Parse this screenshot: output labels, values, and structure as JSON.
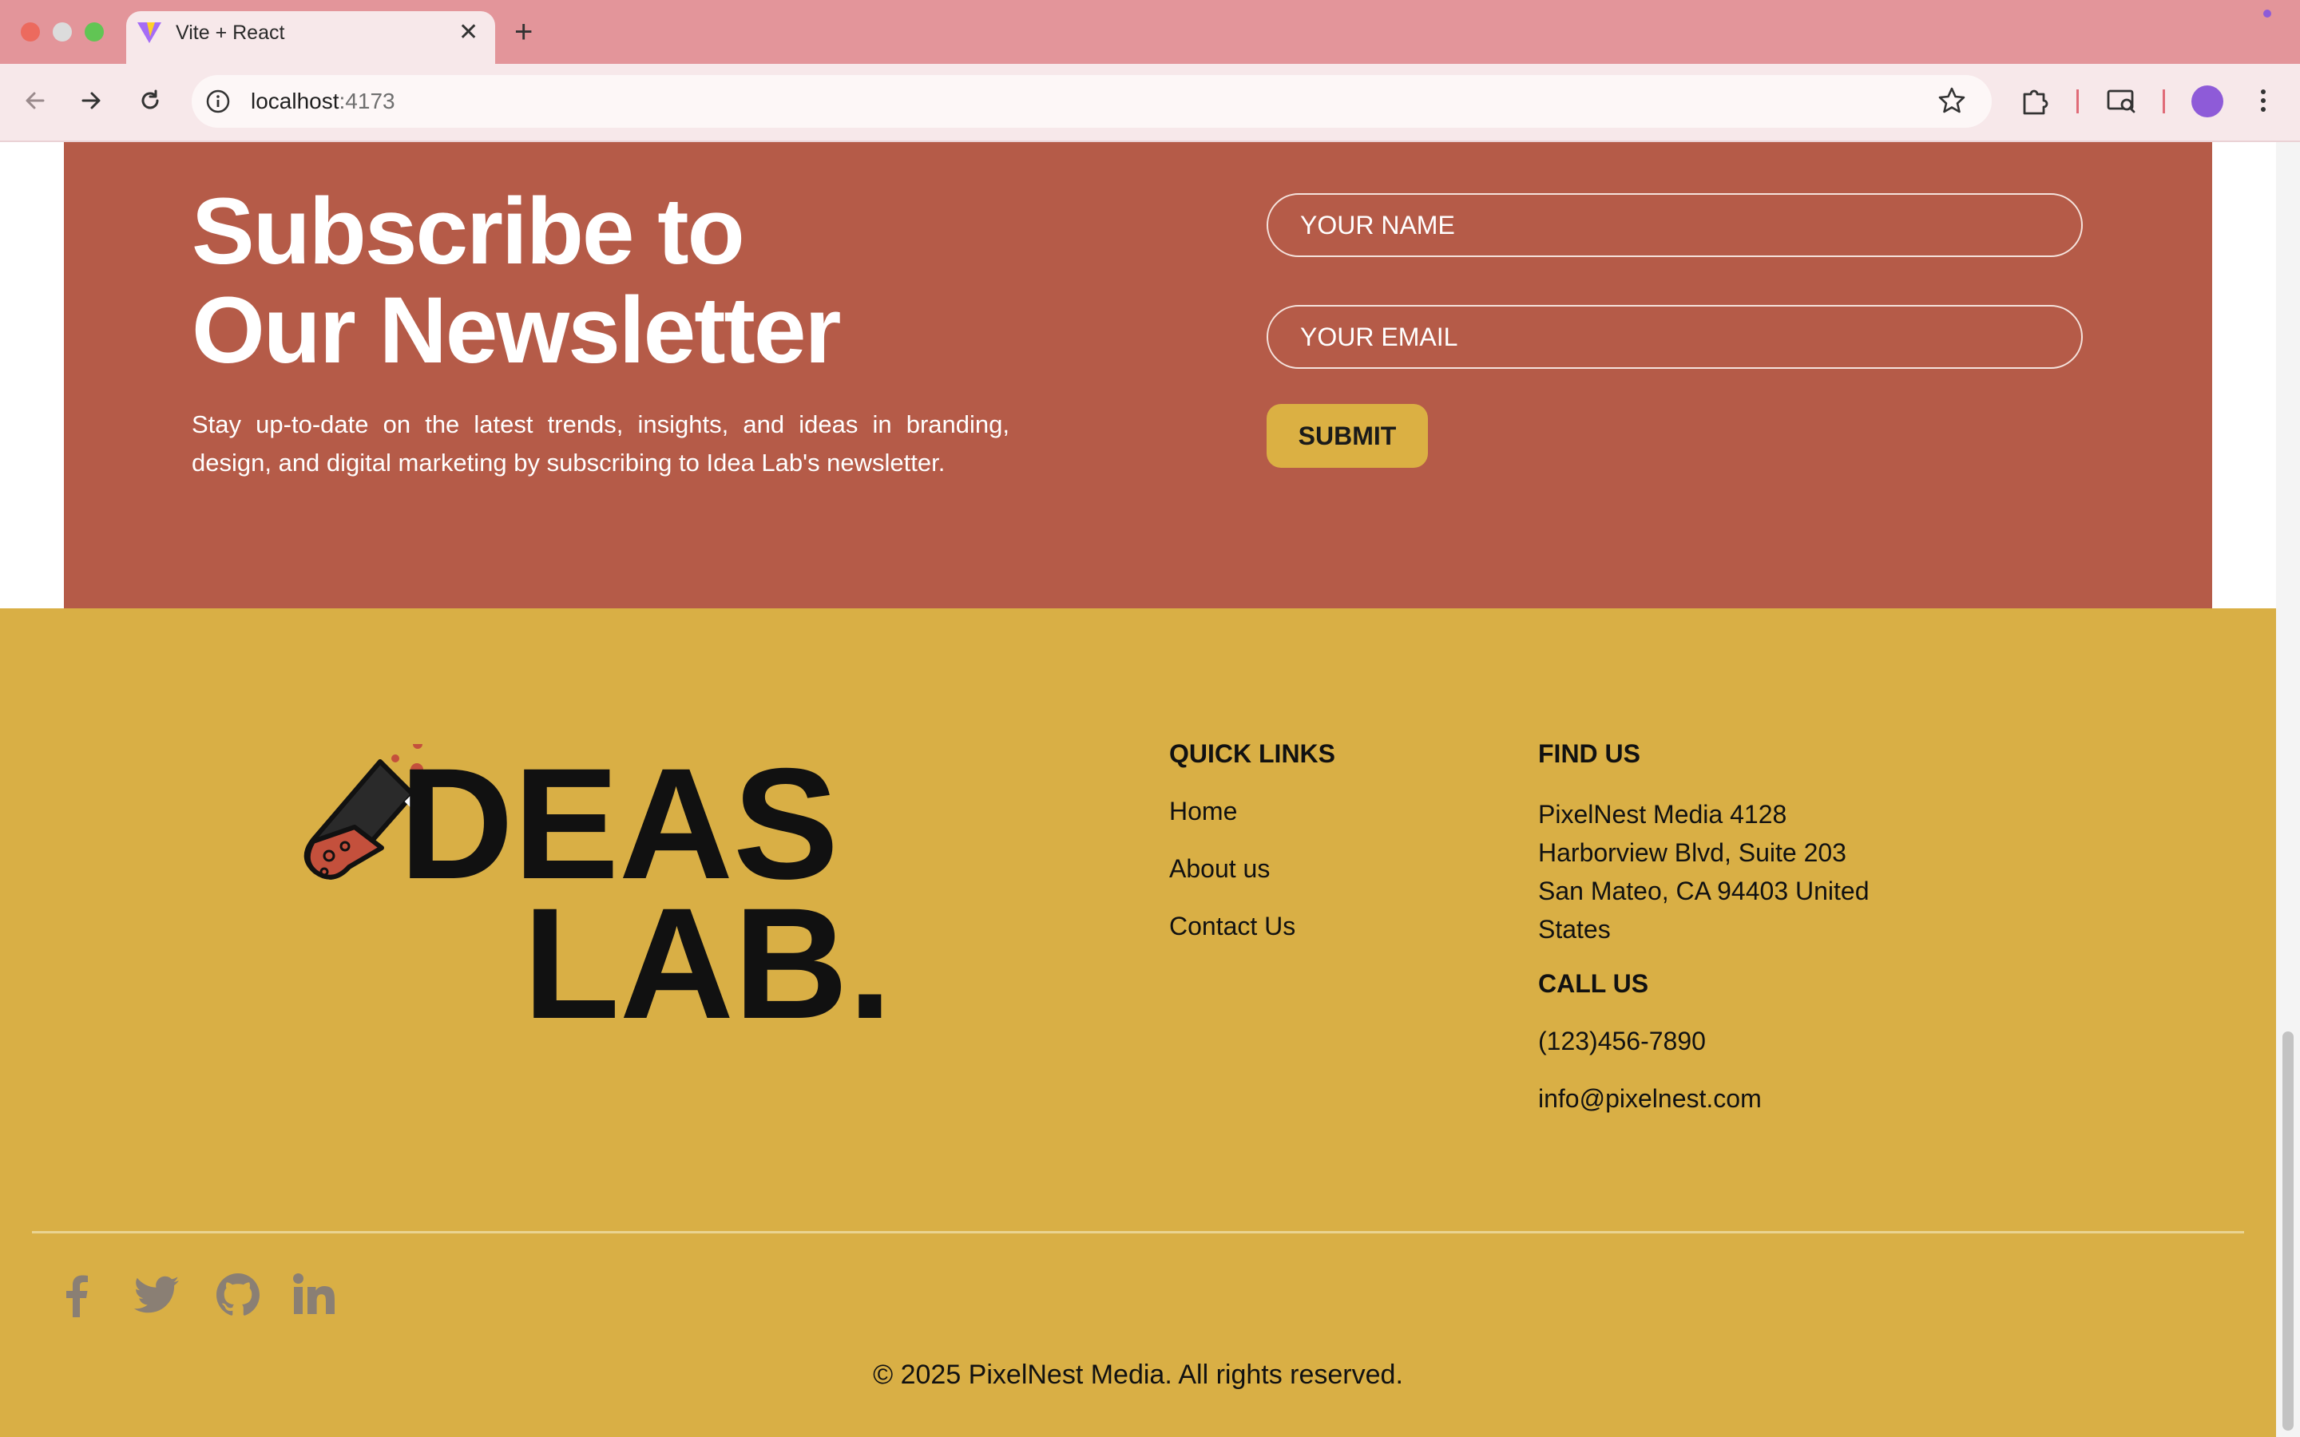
{
  "browser": {
    "tab_title": "Vite + React",
    "url_host": "localhost",
    "url_port": ":4173"
  },
  "newsletter": {
    "title_line1": "Subscribe to",
    "title_line2": "Our Newsletter",
    "description": "Stay up-to-date on the latest trends, insights, and ideas in branding, design, and digital marketing by subscribing to Idea Lab's newsletter.",
    "name_placeholder": "YOUR NAME",
    "email_placeholder": "YOUR EMAIL",
    "submit_label": "SUBMIT"
  },
  "footer": {
    "logo_text_line1": "DEAS",
    "logo_text_line2": "LAB.",
    "quick_links": {
      "heading": "QUICK LINKS",
      "items": [
        "Home",
        "About us",
        "Contact Us"
      ]
    },
    "find_us": {
      "heading": "FIND US",
      "address": "PixelNest Media 4128 Harborview Blvd, Suite 203 San Mateo, CA 94403 United States"
    },
    "call_us": {
      "heading": "CALL US",
      "phone": "(123)456-7890",
      "email": "info@pixelnest.com"
    },
    "social_icons": [
      "facebook-icon",
      "twitter-icon",
      "github-icon",
      "linkedin-icon"
    ],
    "copyright": "© 2025 PixelNest Media. All rights reserved."
  },
  "colors": {
    "newsletter_bg": "#b55b48",
    "footer_bg": "#d9af45",
    "tabbar_bg": "#e3959a",
    "social_icon": "#8a7f74"
  }
}
